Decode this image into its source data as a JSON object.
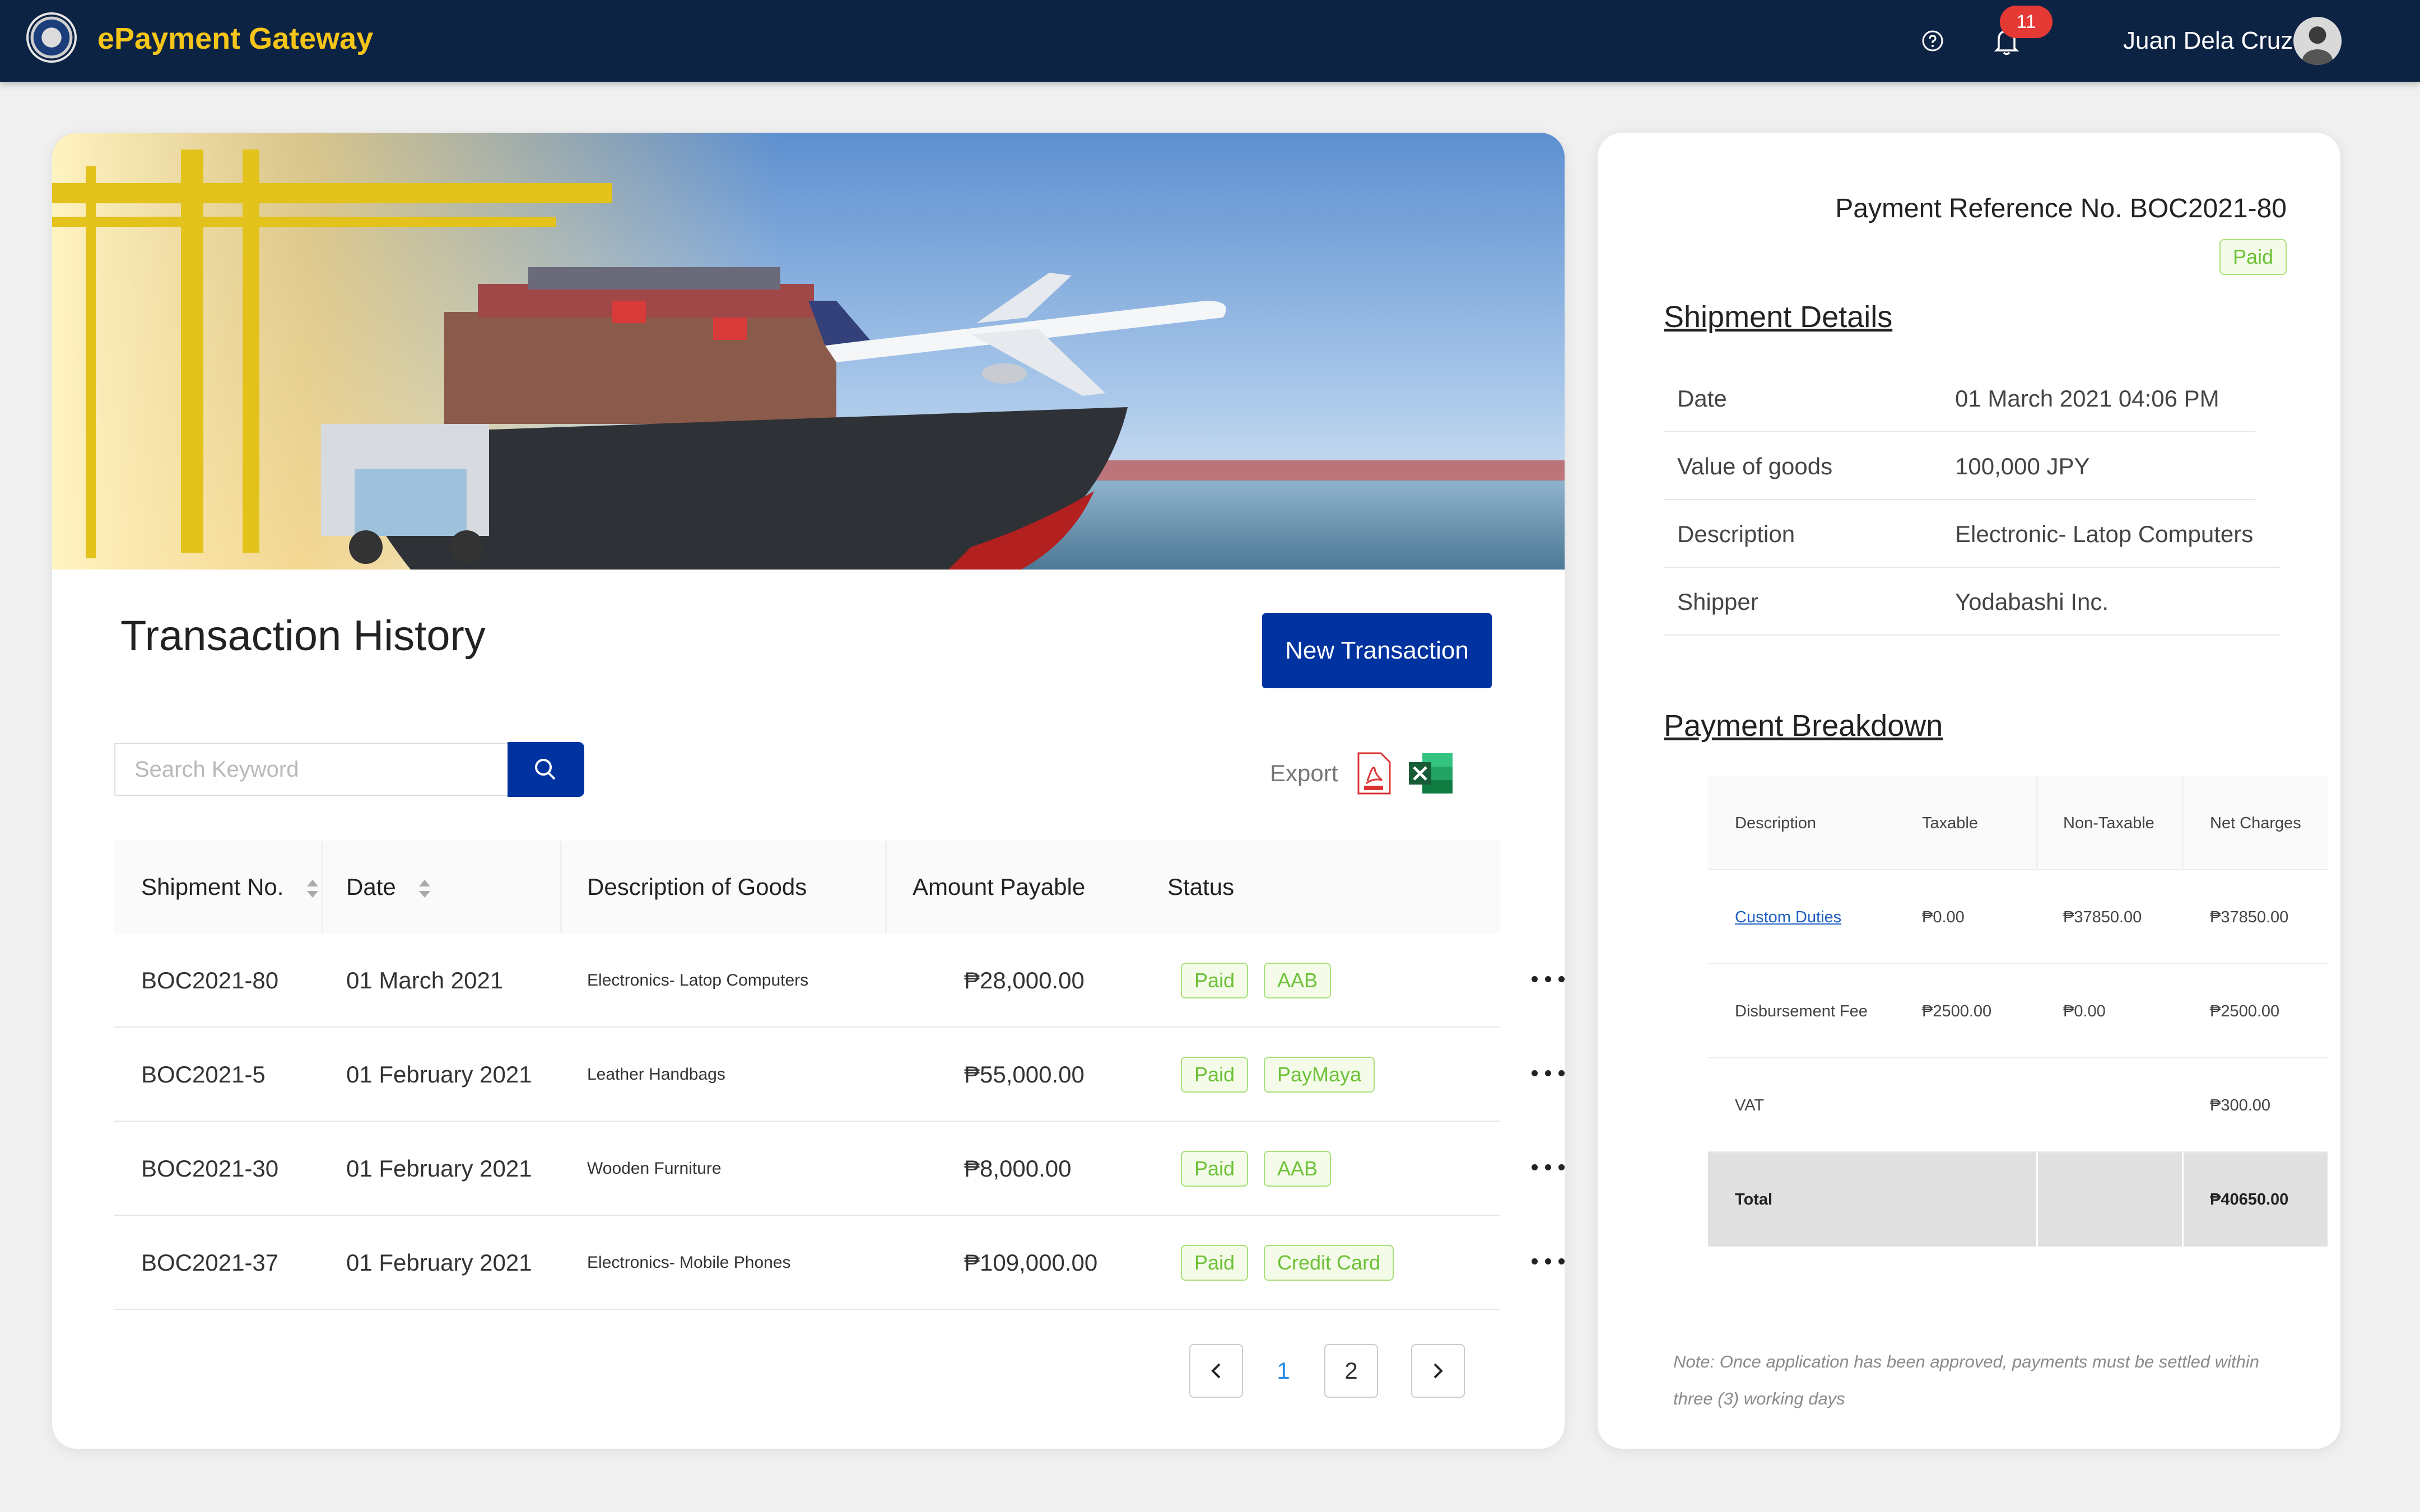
{
  "header": {
    "app_title": "ePayment Gateway",
    "notification_count": "11",
    "user_name": "Juan Dela Cruz"
  },
  "transactions": {
    "title": "Transaction History",
    "new_button": "New Transaction",
    "search_placeholder": "Search Keyword",
    "export_label": "Export",
    "columns": [
      "Shipment No.",
      "Date",
      "Description of Goods",
      "Amount Payable",
      "Status"
    ],
    "rows": [
      {
        "shipment_no": "BOC2021-80",
        "date": "01 March 2021",
        "description": "Electronics- Latop Computers",
        "amount": "₱28,000.00",
        "status": "Paid",
        "method": "AAB"
      },
      {
        "shipment_no": "BOC2021-5",
        "date": "01 February 2021",
        "description": "Leather Handbags",
        "amount": "₱55,000.00",
        "status": "Paid",
        "method": "PayMaya"
      },
      {
        "shipment_no": "BOC2021-30",
        "date": "01 February 2021",
        "description": "Wooden Furniture",
        "amount": "₱8,000.00",
        "status": "Paid",
        "method": "AAB"
      },
      {
        "shipment_no": "BOC2021-37",
        "date": "01 February 2021",
        "description": "Electronics- Mobile Phones",
        "amount": "₱109,000.00",
        "status": "Paid",
        "method": "Credit Card"
      }
    ],
    "pagination": {
      "pages": [
        "1",
        "2"
      ],
      "current": "1"
    }
  },
  "details": {
    "reference": "Payment Reference No. BOC2021-80",
    "status": "Paid",
    "shipment_title": "Shipment Details",
    "shipment": [
      {
        "label": "Date",
        "value": "01 March 2021 04:06 PM"
      },
      {
        "label": "Value of goods",
        "value": "100,000 JPY"
      },
      {
        "label": "Description",
        "value": "Electronic- Latop Computers"
      },
      {
        "label": "Shipper",
        "value": "Yodabashi Inc."
      }
    ],
    "breakdown_title": "Payment Breakdown",
    "breakdown_columns": [
      "Description",
      "Taxable",
      "Non-Taxable",
      "Net Charges"
    ],
    "breakdown": [
      {
        "description": "Custom Duties",
        "taxable": "₱0.00",
        "non_taxable": "₱37850.00",
        "net": "₱37850.00"
      },
      {
        "description": "Disbursement Fee",
        "taxable": "₱2500.00",
        "non_taxable": "₱0.00",
        "net": "₱2500.00"
      },
      {
        "description": "VAT",
        "taxable": "",
        "non_taxable": "",
        "net": "₱300.00"
      }
    ],
    "total": {
      "label": "Total",
      "net": "₱40650.00"
    },
    "note": "Note: Once application has been approved,  payments must be settled within three (3) working days"
  },
  "colors": {
    "navy": "#0d2344",
    "brand_yellow": "#f5c518",
    "primary_blue": "#0033a0",
    "paid_green": "#6cc136"
  }
}
